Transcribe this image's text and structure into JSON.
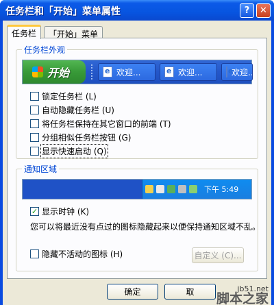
{
  "window": {
    "title": "任务栏和「开始」菜单属性",
    "help_label": "?",
    "close_label": "✕"
  },
  "tabs": [
    {
      "label": "任务栏",
      "active": true
    },
    {
      "label": "「开始」菜单",
      "active": false
    }
  ],
  "appearance": {
    "group_label": "任务栏外观",
    "start_label": "开始",
    "task_items": [
      "欢迎...",
      "欢迎...",
      "欢迎..."
    ],
    "options": [
      {
        "label": "锁定任务栏 (L)",
        "checked": false
      },
      {
        "label": "自动隐藏任务栏 (U)",
        "checked": false
      },
      {
        "label": "将任务栏保持在其它窗口的前端 (T)",
        "checked": false
      },
      {
        "label": "分组相似任务栏按钮 (G)",
        "checked": false
      },
      {
        "label": "显示快速启动 (Q)",
        "checked": false
      }
    ]
  },
  "notification": {
    "group_label": "通知区域",
    "clock_text": "下午 5:49",
    "show_clock": {
      "label": "显示时钟 (K)",
      "checked": true
    },
    "description": "您可以将最近没有点过的图标隐藏起来以便保持通知区域不乱。",
    "hide_inactive": {
      "label": "隐藏不活动的图标 (H)",
      "checked": false
    },
    "customize_label": "自定义 (C)..."
  },
  "footer": {
    "ok_label": "确定",
    "cancel_label": "取"
  },
  "watermark": {
    "url": "jb51.net",
    "brand": "脚本之家"
  },
  "colors": {
    "title_blue": "#0755e0",
    "group_label_blue": "#0046d5",
    "check_green": "#21a121",
    "panel_bg": "#ece9d8"
  }
}
